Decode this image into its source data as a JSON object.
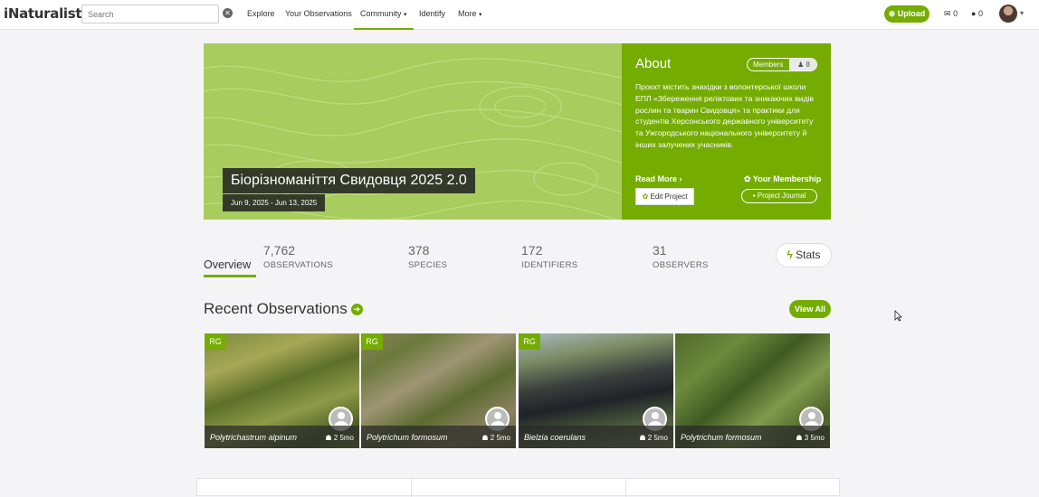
{
  "nav": {
    "logo": "iNaturalist",
    "search_placeholder": "Search",
    "links": [
      "Explore",
      "Your Observations",
      "Community",
      "Identify",
      "More"
    ],
    "upload_label": "Upload",
    "messages_count": "0",
    "notifications_count": "0"
  },
  "project": {
    "title": "Біорізноманіття Свидовця 2025 2.0",
    "dates": "Jun 9, 2025 - Jun 13, 2025"
  },
  "about": {
    "heading": "About",
    "members_label": "Members",
    "members_count": "8",
    "description": "Проєкт містить знахідки з волонтерської школи ЕПЛ «Збереження реліктових та зникаючих видів рослин та тварин Свидовця» та практики для студентів Херсонського державного університету та Ужгородського національного університету й інших залучених учасників.",
    "read_more": "Read More",
    "your_membership": "Your Membership",
    "edit_project": "Edit Project",
    "project_journal": "Project Journal"
  },
  "tabs": {
    "overview": "Overview",
    "stats_label": "Stats"
  },
  "stats": [
    {
      "value": "7,762",
      "label": "OBSERVATIONS"
    },
    {
      "value": "378",
      "label": "SPECIES"
    },
    {
      "value": "172",
      "label": "IDENTIFIERS"
    },
    {
      "value": "31",
      "label": "OBSERVERS"
    }
  ],
  "recent": {
    "heading": "Recent Observations",
    "view_all": "View All",
    "observations": [
      {
        "badge": "RG",
        "species": "Polytrichastrum alpinum",
        "ids": "2",
        "age": "5mo"
      },
      {
        "badge": "RG",
        "species": "Polytrichum formosum",
        "ids": "2",
        "age": "5mo"
      },
      {
        "badge": "RG",
        "species": "Bielzia coerulans",
        "ids": "2",
        "age": "5mo"
      },
      {
        "badge": "",
        "species": "Polytrichum formosum",
        "ids": "3",
        "age": "5mo"
      }
    ]
  },
  "colors": {
    "accent": "#74ac00",
    "hero_bg": "#a8cc5d",
    "title_bg": "#333a2a"
  },
  "icons": [
    "search-clear-icon",
    "upload-icon",
    "envelope-icon",
    "comment-icon",
    "user-icon",
    "gear-icon",
    "journal-icon",
    "bolt-icon",
    "arrow-right-circle-icon",
    "thumb-icon"
  ]
}
